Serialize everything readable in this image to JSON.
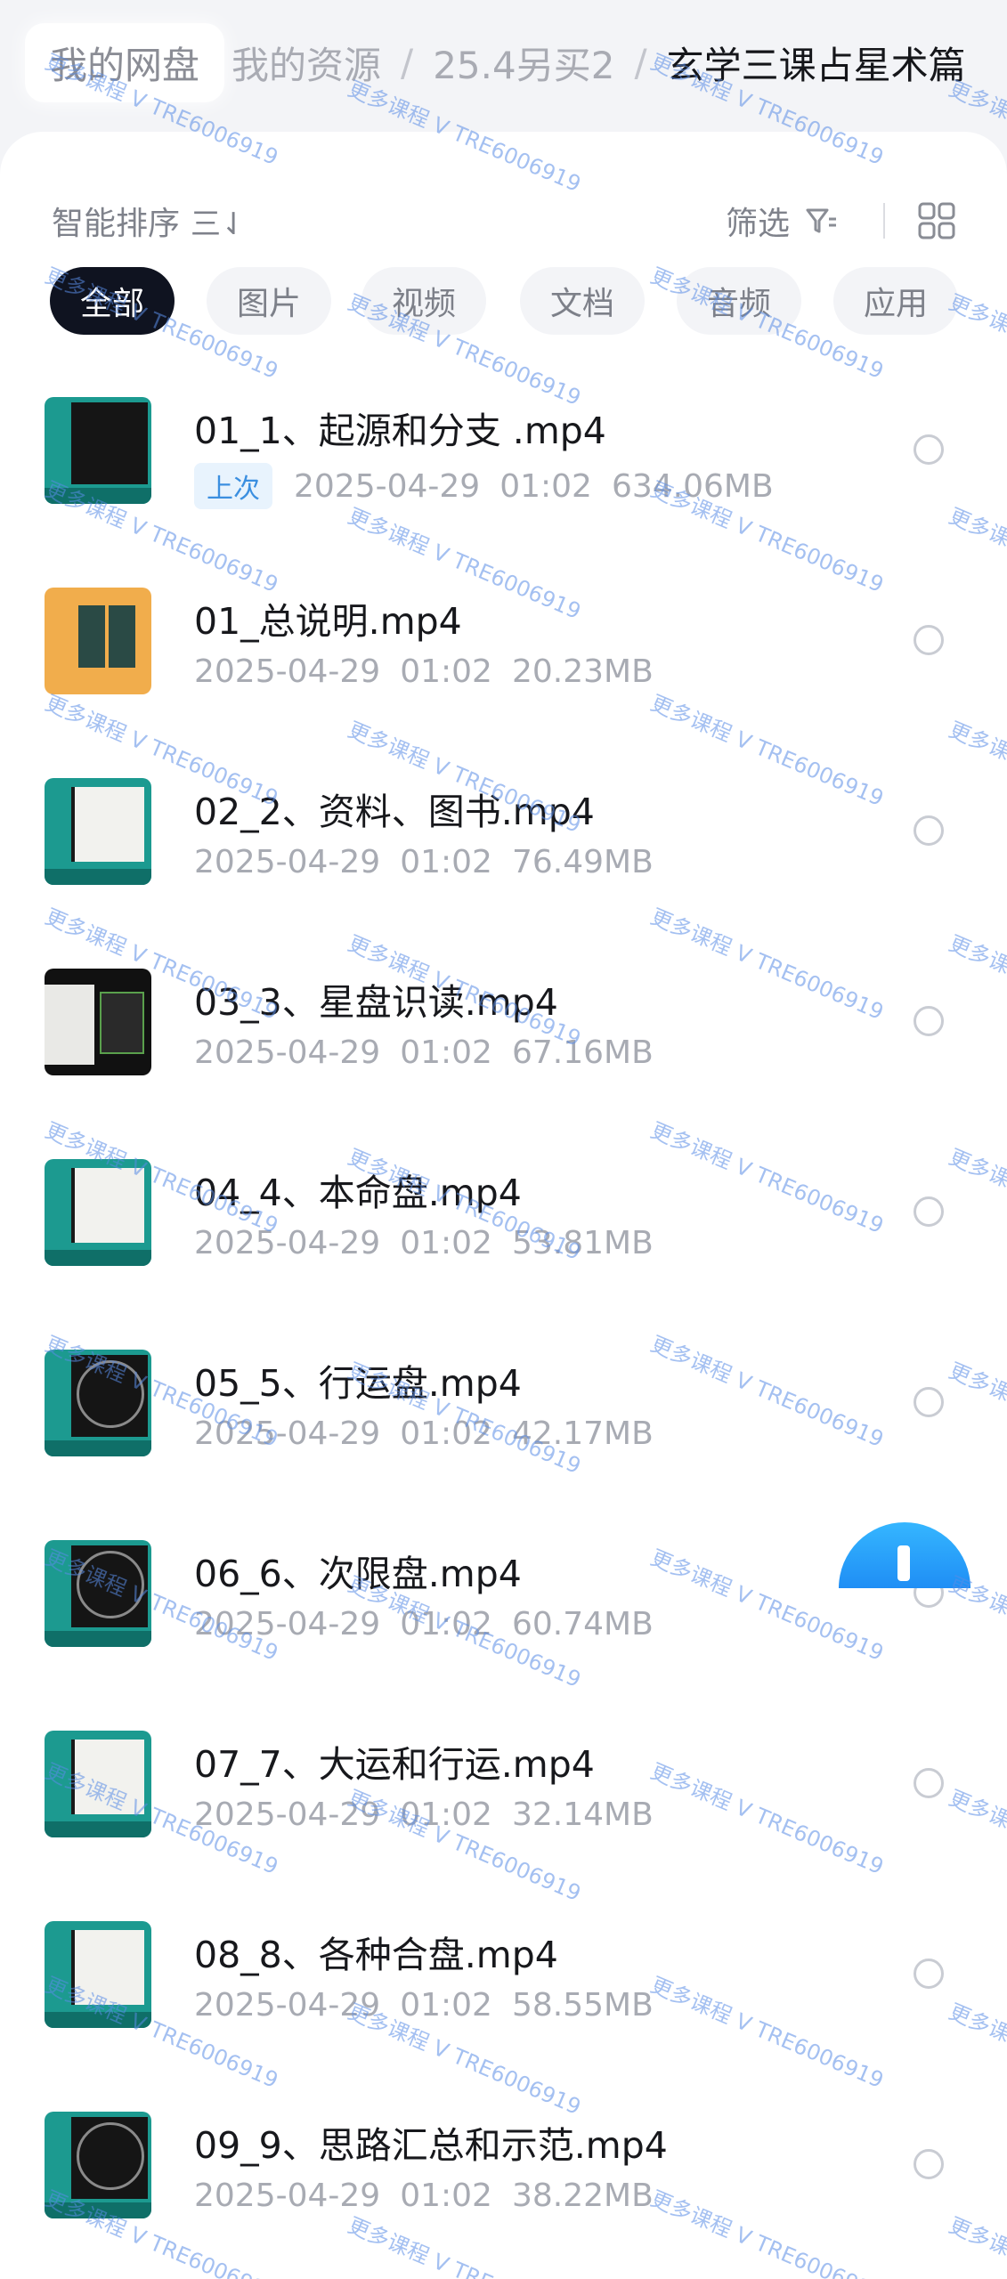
{
  "breadcrumb": {
    "root": "我的网盘",
    "level1": "我的资源",
    "level2": "25.4另买2",
    "current": "玄学三课占星术篇",
    "separator": "/"
  },
  "toolbar": {
    "sort_label": "智能排序",
    "sort_icon": "三⇃",
    "filter_label": "筛选"
  },
  "chips": [
    "全部",
    "图片",
    "视频",
    "文档",
    "音频",
    "应用"
  ],
  "files": [
    {
      "name": "01_1、起源和分支 .mp4",
      "tag": "上次",
      "date": "2025-04-29",
      "time": "01:02",
      "size": "634.06MB"
    },
    {
      "name": "01_总说明.mp4",
      "date": "2025-04-29",
      "time": "01:02",
      "size": "20.23MB"
    },
    {
      "name": "02_2、资料、图书.mp4",
      "date": "2025-04-29",
      "time": "01:02",
      "size": "76.49MB"
    },
    {
      "name": "03_3、星盘识读.mp4",
      "date": "2025-04-29",
      "time": "01:02",
      "size": "67.16MB"
    },
    {
      "name": "04_4、本命盘.mp4",
      "date": "2025-04-29",
      "time": "01:02",
      "size": "53.81MB"
    },
    {
      "name": "05_5、行运盘.mp4",
      "date": "2025-04-29",
      "time": "01:02",
      "size": "42.17MB"
    },
    {
      "name": "06_6、次限盘.mp4",
      "date": "2025-04-29",
      "time": "01:02",
      "size": "60.74MB"
    },
    {
      "name": "07_7、大运和行运.mp4",
      "date": "2025-04-29",
      "time": "01:02",
      "size": "32.14MB"
    },
    {
      "name": "08_8、各种合盘.mp4",
      "date": "2025-04-29",
      "time": "01:02",
      "size": "58.55MB"
    },
    {
      "name": "09_9、思路汇总和示范.mp4",
      "date": "2025-04-29",
      "time": "01:02",
      "size": "38.22MB"
    }
  ],
  "watermark": "更多课程 V TRE6006919",
  "colors": {
    "accent": "#3b8fe0",
    "chip_active": "#0f1320",
    "fab": "#1f8ef5"
  }
}
